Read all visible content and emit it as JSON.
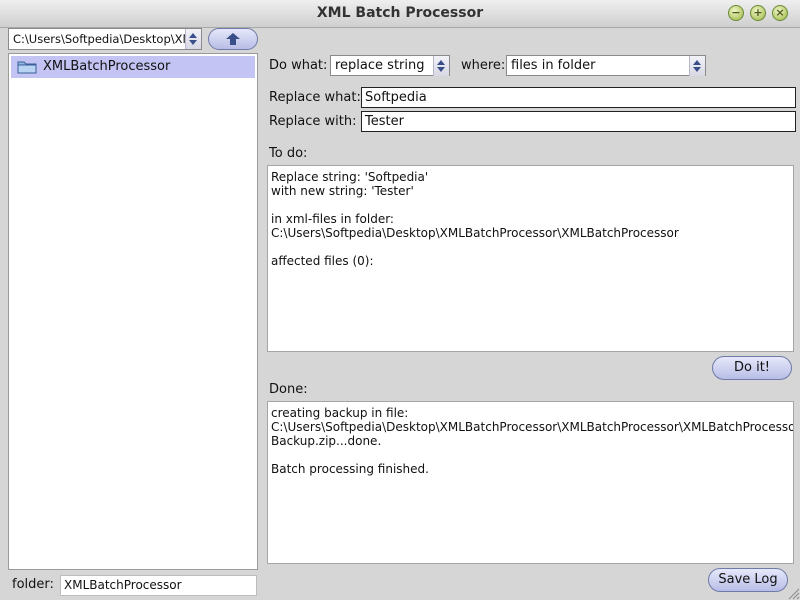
{
  "window": {
    "title": "XML Batch Processor"
  },
  "left": {
    "path_value": "C:\\Users\\Softpedia\\Desktop\\XMLBat...",
    "tree_items": [
      {
        "label": "XMLBatchProcessor"
      }
    ],
    "folder_label": "folder:",
    "folder_value": "XMLBatchProcessor"
  },
  "form": {
    "do_what_label": "Do what:",
    "do_what_value": "replace string",
    "where_label": "where:",
    "where_value": "files in folder",
    "replace_what_label": "Replace what:",
    "replace_what_value": "Softpedia",
    "replace_with_label": "Replace with:",
    "replace_with_value": "Tester"
  },
  "todo": {
    "label": "To do:",
    "text": "Replace string: 'Softpedia'\nwith new string: 'Tester'\n\nin xml-files in folder:\nC:\\Users\\Softpedia\\Desktop\\XMLBatchProcessor\\XMLBatchProcessor\n\naffected files (0):"
  },
  "do_it_button": "Do it!",
  "done": {
    "label": "Done:",
    "text": "creating backup in file:\nC:\\Users\\Softpedia\\Desktop\\XMLBatchProcessor\\XMLBatchProcessor\\XMLBatchProcessorl\nBackup.zip...done.\n\nBatch processing finished."
  },
  "save_log_button": "Save Log",
  "icons": {
    "minimize": "minimize-icon",
    "maximize": "maximize-icon",
    "close": "close-icon",
    "up_arrow": "arrow-up-icon",
    "folder": "folder-icon"
  },
  "colors": {
    "selection": "#c4c4f4",
    "button_fill": "#b8bde6",
    "window_buttons": "#9ab53c"
  }
}
